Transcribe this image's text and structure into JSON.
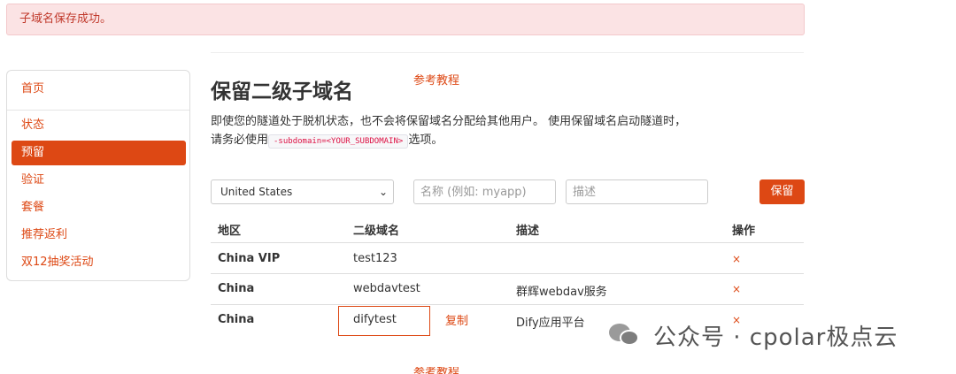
{
  "alert": {
    "message": "子域名保存成功。"
  },
  "sidebar": {
    "items": [
      {
        "label": "首页"
      },
      {
        "label": "状态"
      },
      {
        "label": "预留"
      },
      {
        "label": "验证"
      },
      {
        "label": "套餐"
      },
      {
        "label": "推荐返利"
      },
      {
        "label": "双12抽奖活动"
      }
    ]
  },
  "main": {
    "title": "保留二级子域名",
    "tutorial_link": "参考教程",
    "desc_part1": "即使您的隧道处于脱机状态，也不会将保留域名分配给其他用户。 使用保留域名启动隧道时，请务必使用",
    "desc_code": "-subdomain=<YOUR_SUBDOMAIN>",
    "desc_part2": "选项。"
  },
  "form": {
    "region_selected": "United States",
    "name_placeholder": "名称 (例如: myapp)",
    "desc_placeholder": "描述",
    "reserve_button": "保留"
  },
  "table": {
    "headers": {
      "region": "地区",
      "subdomain": "二级域名",
      "description": "描述",
      "action": "操作"
    },
    "delete_symbol": "×",
    "rows": [
      {
        "region": "China VIP",
        "subdomain": "test123",
        "description": ""
      },
      {
        "region": "China",
        "subdomain": "webdavtest",
        "description": "群辉webdav服务"
      },
      {
        "region": "China",
        "subdomain": "difytest",
        "description": "Dify应用平台"
      }
    ]
  },
  "annotation": {
    "copy_label": "复制"
  },
  "watermark": {
    "text": "公众号 · cpolar极点云"
  },
  "bottom_link": "参考教程",
  "colors": {
    "accent": "#dd4814",
    "alert_bg": "#fbe3e4",
    "alert_text": "#c0392b"
  }
}
